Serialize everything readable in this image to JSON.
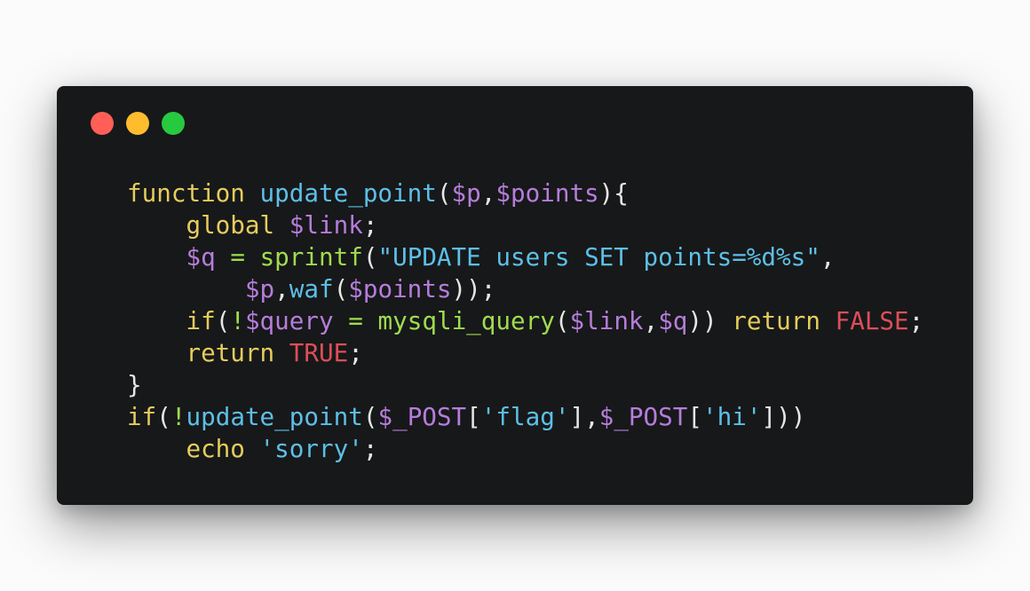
{
  "window": {
    "background": "#171819",
    "buttons": [
      {
        "name": "close",
        "color": "#ff5f56"
      },
      {
        "name": "minimize",
        "color": "#ffbd2e"
      },
      {
        "name": "maximize",
        "color": "#27c93f"
      }
    ]
  },
  "theme": {
    "keyword": "#e5cd5e",
    "function": "#5dbfe7",
    "variable": "#b67ddb",
    "string": "#5dbfe7",
    "constant": "#dc4e5a",
    "operator": "#9fdc50",
    "plain": "#e6e6e6"
  },
  "code_lines": [
    {
      "indent": "",
      "tokens": [
        {
          "t": "function",
          "k": "keyword"
        },
        {
          "t": " ",
          "k": "plain"
        },
        {
          "t": "update_point",
          "k": "function"
        },
        {
          "t": "(",
          "k": "plain"
        },
        {
          "t": "$p",
          "k": "variable"
        },
        {
          "t": ",",
          "k": "plain"
        },
        {
          "t": "$points",
          "k": "variable"
        },
        {
          "t": "){",
          "k": "plain"
        }
      ]
    },
    {
      "indent": "    ",
      "tokens": [
        {
          "t": "global",
          "k": "keyword"
        },
        {
          "t": " ",
          "k": "plain"
        },
        {
          "t": "$link",
          "k": "variable"
        },
        {
          "t": ";",
          "k": "plain"
        }
      ]
    },
    {
      "indent": "    ",
      "tokens": [
        {
          "t": "$q",
          "k": "variable"
        },
        {
          "t": " ",
          "k": "plain"
        },
        {
          "t": "=",
          "k": "operator"
        },
        {
          "t": " ",
          "k": "plain"
        },
        {
          "t": "sprintf",
          "k": "operator"
        },
        {
          "t": "(",
          "k": "plain"
        },
        {
          "t": "\"UPDATE users SET points=%d%s\"",
          "k": "string"
        },
        {
          "t": ",",
          "k": "plain"
        }
      ]
    },
    {
      "indent": "        ",
      "tokens": [
        {
          "t": "$p",
          "k": "variable"
        },
        {
          "t": ",",
          "k": "plain"
        },
        {
          "t": "waf",
          "k": "function"
        },
        {
          "t": "(",
          "k": "plain"
        },
        {
          "t": "$points",
          "k": "variable"
        },
        {
          "t": "));",
          "k": "plain"
        }
      ]
    },
    {
      "indent": "    ",
      "tokens": [
        {
          "t": "if",
          "k": "keyword"
        },
        {
          "t": "(",
          "k": "plain"
        },
        {
          "t": "!",
          "k": "operator"
        },
        {
          "t": "$query",
          "k": "variable"
        },
        {
          "t": " ",
          "k": "plain"
        },
        {
          "t": "=",
          "k": "operator"
        },
        {
          "t": " ",
          "k": "plain"
        },
        {
          "t": "mysqli_query",
          "k": "operator"
        },
        {
          "t": "(",
          "k": "plain"
        },
        {
          "t": "$link",
          "k": "variable"
        },
        {
          "t": ",",
          "k": "plain"
        },
        {
          "t": "$q",
          "k": "variable"
        },
        {
          "t": "))",
          "k": "plain"
        },
        {
          "t": " ",
          "k": "plain"
        },
        {
          "t": "return",
          "k": "keyword"
        },
        {
          "t": " ",
          "k": "plain"
        },
        {
          "t": "FALSE",
          "k": "constant"
        },
        {
          "t": ";",
          "k": "plain"
        }
      ]
    },
    {
      "indent": "    ",
      "tokens": [
        {
          "t": "return",
          "k": "keyword"
        },
        {
          "t": " ",
          "k": "plain"
        },
        {
          "t": "TRUE",
          "k": "constant"
        },
        {
          "t": ";",
          "k": "plain"
        }
      ]
    },
    {
      "indent": "",
      "tokens": [
        {
          "t": "}",
          "k": "plain"
        }
      ]
    },
    {
      "indent": "",
      "tokens": [
        {
          "t": "if",
          "k": "keyword"
        },
        {
          "t": "(",
          "k": "plain"
        },
        {
          "t": "!",
          "k": "operator"
        },
        {
          "t": "update_point",
          "k": "function"
        },
        {
          "t": "(",
          "k": "plain"
        },
        {
          "t": "$_POST",
          "k": "variable"
        },
        {
          "t": "[",
          "k": "plain"
        },
        {
          "t": "'flag'",
          "k": "string"
        },
        {
          "t": "],",
          "k": "plain"
        },
        {
          "t": "$_POST",
          "k": "variable"
        },
        {
          "t": "[",
          "k": "plain"
        },
        {
          "t": "'hi'",
          "k": "string"
        },
        {
          "t": "]))",
          "k": "plain"
        }
      ]
    },
    {
      "indent": "    ",
      "tokens": [
        {
          "t": "echo",
          "k": "keyword"
        },
        {
          "t": " ",
          "k": "plain"
        },
        {
          "t": "'sorry'",
          "k": "string"
        },
        {
          "t": ";",
          "k": "plain"
        }
      ]
    }
  ]
}
